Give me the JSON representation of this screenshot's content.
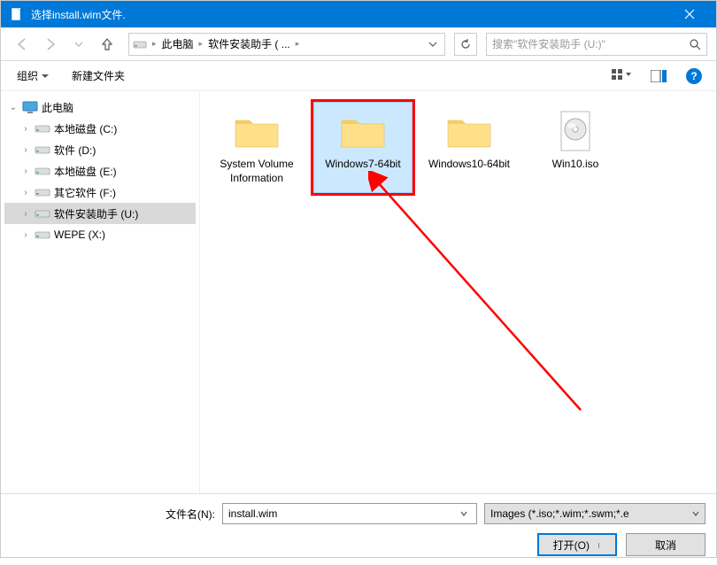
{
  "titlebar": {
    "title": "选择install.wim文件."
  },
  "nav": {
    "crumbs": [
      "此电脑",
      "软件安装助手 ( ..."
    ],
    "search_placeholder": "搜索\"软件安装助手 (U:)\""
  },
  "toolbar": {
    "organize": "组织",
    "new_folder": "新建文件夹"
  },
  "sidebar": {
    "root": "此电脑",
    "items": [
      {
        "label": "本地磁盘 (C:)"
      },
      {
        "label": "软件 (D:)"
      },
      {
        "label": "本地磁盘 (E:)"
      },
      {
        "label": "其它软件 (F:)"
      },
      {
        "label": "软件安装助手 (U:)",
        "selected": true
      },
      {
        "label": "WEPE (X:)"
      }
    ]
  },
  "files": [
    {
      "name": "System Volume Information",
      "type": "folder"
    },
    {
      "name": "Windows7-64bit",
      "type": "folder",
      "selected": true,
      "highlighted": true
    },
    {
      "name": "Windows10-64bit",
      "type": "folder"
    },
    {
      "name": "Win10.iso",
      "type": "iso"
    }
  ],
  "footer": {
    "filename_label": "文件名(N):",
    "filename_value": "install.wim",
    "filter_text": "Images (*.iso;*.wim;*.swm;*.e",
    "open": "打开(O)",
    "cancel": "取消"
  }
}
